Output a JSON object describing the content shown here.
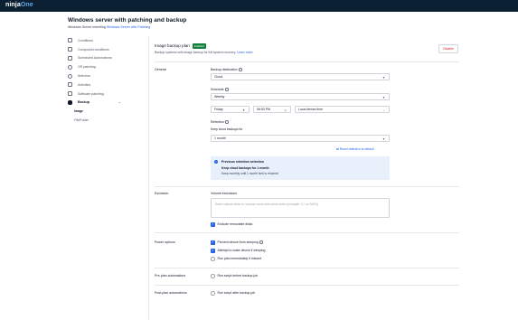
{
  "app": {
    "logo_main": "ninja",
    "logo_accent": "One"
  },
  "page": {
    "title": "Windows server with patching and backup",
    "subtitle_prefix": "Windows Server inheriting ",
    "subtitle_link": "Windows Server with Patching"
  },
  "sidebar": {
    "items": [
      {
        "label": "Conditions",
        "icon": "conditions-icon"
      },
      {
        "label": "Compound conditions",
        "icon": "compound-icon"
      },
      {
        "label": "Scheduled Automations",
        "icon": "calendar-icon"
      },
      {
        "label": "OS patching",
        "icon": "gear-icon"
      },
      {
        "label": "Antivirus",
        "icon": "shield-icon"
      },
      {
        "label": "Activities",
        "icon": "list-icon"
      },
      {
        "label": "Software patching",
        "icon": "window-icon"
      },
      {
        "label": "Backup",
        "icon": "cloud-icon",
        "chevron": "⌄"
      }
    ],
    "subitems": [
      {
        "label": "Image"
      },
      {
        "label": "File/Folder"
      }
    ]
  },
  "plan": {
    "title": "Image backup plan",
    "badge": "Enabled",
    "description": "Backup systems with image backup for full system recovery.",
    "learn_more": "Learn more",
    "disable_label": "Disable"
  },
  "general": {
    "section": "General",
    "destination_label": "Backup destination",
    "destination_value": "Cloud",
    "schedule_label": "Schedule",
    "schedule_value": "Weekly",
    "day_value": "Friday",
    "time_value": "06:00 PM",
    "timezone_value": "Local device time",
    "retention_label": "Retention",
    "keep_label": "Keep cloud backups for",
    "keep_value": "1 month",
    "reset_link": "Reset retention to default",
    "alert_title": "Previous retention selection",
    "alert_line1": "Keep cloud backups for 1 month",
    "alert_line2": "Keep monthly until 1 month limit is reached"
  },
  "exclusion": {
    "section": "Exclusion",
    "volume_label": "Volume exclusions",
    "placeholder": "Enter volume letter or volume name and press enter (example: C:\\ or DATA)",
    "removable_label": "Exclude removable disks",
    "removable_checked": true
  },
  "power": {
    "section": "Power options",
    "prevent_sleep": "Prevent device from sleeping",
    "wake_device": "Attempt to wake device if sleeping",
    "run_missed": "Run plan immediately if missed"
  },
  "pre": {
    "section": "Pre-plan automations",
    "label": "Run script before backup job"
  },
  "post": {
    "section": "Post-plan automations",
    "label": "Run script after backup job"
  },
  "colors": {
    "topbar": "#0b1f33",
    "accent": "#2563eb",
    "badge": "#15803d",
    "danger": "#dc2626"
  }
}
